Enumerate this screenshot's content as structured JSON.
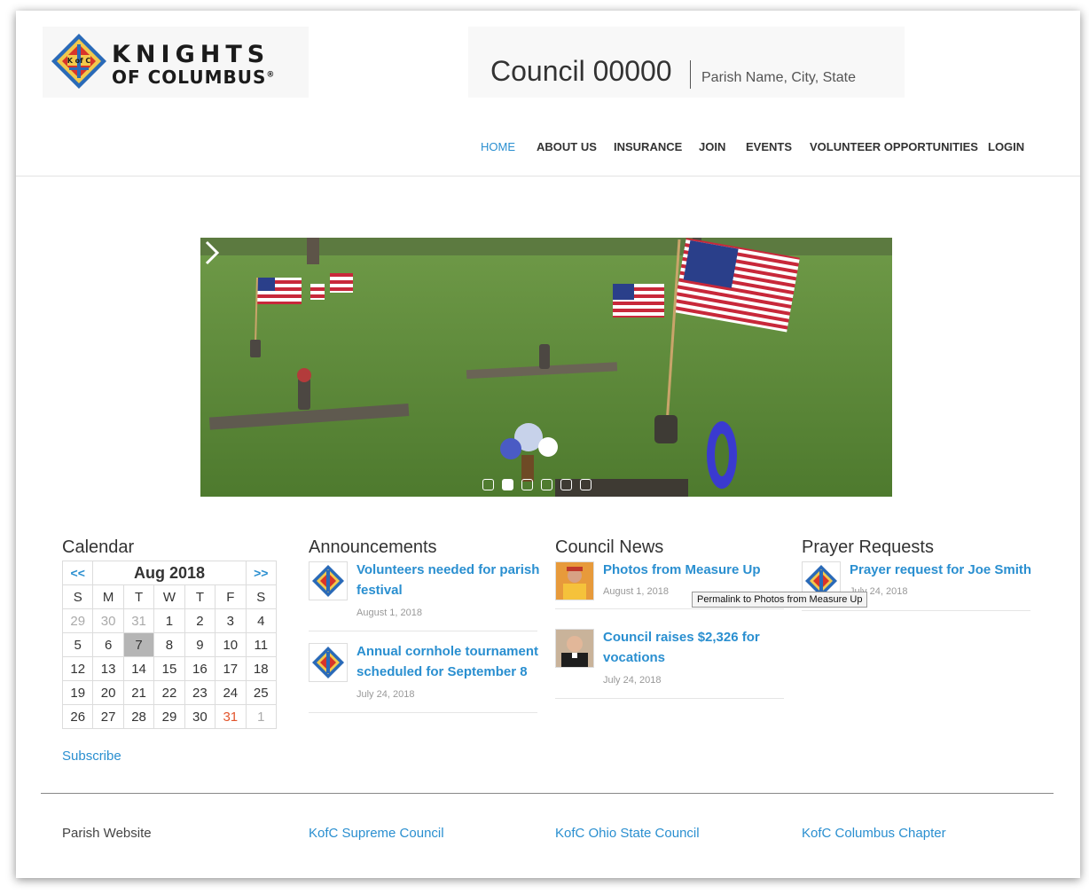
{
  "brand": {
    "logo_line1": "KNIGHTS",
    "logo_line2": "OF COLUMBUS",
    "logo_mark": "®",
    "emblem_text": "K of C"
  },
  "council": {
    "name": "Council 00000",
    "subtitle": "Parish Name, City, State"
  },
  "nav": {
    "items": [
      "HOME",
      "ABOUT US",
      "INSURANCE",
      "JOIN",
      "EVENTS",
      "VOLUNTEER OPPORTUNITIES",
      "LOGIN"
    ],
    "active": "HOME"
  },
  "slider": {
    "slide_count": 6,
    "active_slide": 2
  },
  "calendar": {
    "title": "Calendar",
    "month": "Aug 2018",
    "prev": "<<",
    "next": ">>",
    "weekdays": [
      "S",
      "M",
      "T",
      "W",
      "T",
      "F",
      "S"
    ],
    "weeks": [
      [
        "29",
        "30",
        "31",
        "1",
        "2",
        "3",
        "4"
      ],
      [
        "5",
        "6",
        "7",
        "8",
        "9",
        "10",
        "11"
      ],
      [
        "12",
        "13",
        "14",
        "15",
        "16",
        "17",
        "18"
      ],
      [
        "19",
        "20",
        "21",
        "22",
        "23",
        "24",
        "25"
      ],
      [
        "26",
        "27",
        "28",
        "29",
        "30",
        "31",
        "1"
      ]
    ],
    "subscribe": "Subscribe"
  },
  "announcements": {
    "title": "Announcements",
    "posts": [
      {
        "title": "Volunteers needed for parish festival",
        "date": "August 1, 2018"
      },
      {
        "title": "Annual cornhole tournament scheduled for September 8",
        "date": "July 24, 2018"
      }
    ]
  },
  "council_news": {
    "title": "Council News",
    "posts": [
      {
        "title": "Photos from Measure Up",
        "date": "August 1, 2018"
      },
      {
        "title": "Council raises $2,326 for vocations",
        "date": "July 24, 2018"
      }
    ],
    "tooltip": "Permalink to Photos from Measure Up"
  },
  "prayer_requests": {
    "title": "Prayer Requests",
    "posts": [
      {
        "title": "Prayer request for Joe Smith",
        "date": "July 24, 2018"
      }
    ]
  },
  "footer": {
    "links": [
      "Parish Website",
      "KofC Supreme Council",
      "KofC Ohio State Council",
      "KofC Columbus Chapter"
    ]
  },
  "colors": {
    "link": "#2a8fd0",
    "text": "#333333",
    "highlight": "#e2542b"
  }
}
